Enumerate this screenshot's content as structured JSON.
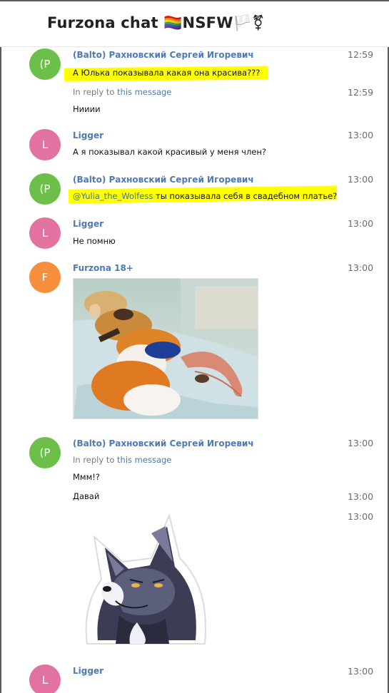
{
  "chat": {
    "title": "Furzona chat 🏳️‍🌈NSFW🏳️⚧"
  },
  "messages": [
    {
      "avatar_letter": "(P",
      "sender": "(Balto) Рахновский Сергей Игоревич",
      "time": "12:59",
      "text": "А Юлька показывала какая она красива???"
    },
    {
      "reply_prefix": "In reply to ",
      "reply_link": "this message",
      "time": "12:59",
      "text": "Нииии"
    },
    {
      "avatar_letter": "L",
      "sender": "Ligger",
      "time": "13:00",
      "text": "А я показывал какой красивый у меня член?"
    },
    {
      "avatar_letter": "(P",
      "sender": "(Balto) Рахновский Сергей Игоревич",
      "time": "13:00",
      "mention": "@Yulia_the_Wolfess",
      "text": " ты показывала себя в свадебном платье?"
    },
    {
      "avatar_letter": "L",
      "sender": "Ligger",
      "time": "13:00",
      "text": "Не помню"
    },
    {
      "avatar_letter": "F",
      "sender": "Furzona 18+",
      "time": "13:00"
    },
    {
      "avatar_letter": "(P",
      "sender": "(Balto) Рахновский Сергей Игоревич",
      "time": "13:00",
      "reply_prefix": "In reply to ",
      "reply_link": "this message",
      "text": "Ммм!?"
    },
    {
      "time": "13:00",
      "text": "Давай"
    },
    {
      "time": "13:00"
    },
    {
      "avatar_letter": "L",
      "sender": "Ligger",
      "time": "13:00"
    }
  ],
  "colors": {
    "avatar_green": "#6cc04a",
    "avatar_pink": "#e2729f",
    "avatar_orange": "#f58f3e",
    "sender_blue": "#4d7ab5",
    "highlight": "#ffff00"
  }
}
